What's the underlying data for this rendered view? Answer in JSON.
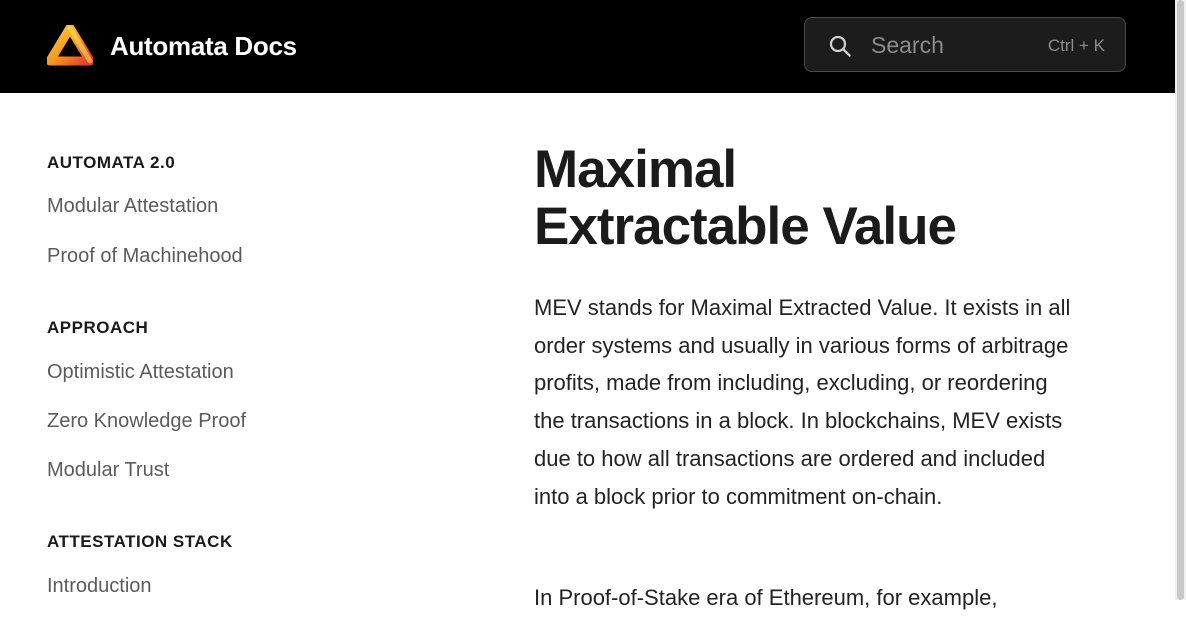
{
  "header": {
    "title": "Automata Docs",
    "logo_icon": "automata-triangle-logo",
    "background": "#000000"
  },
  "search": {
    "icon": "search-icon",
    "placeholder": "Search",
    "shortcut": "Ctrl + K"
  },
  "sidebar": {
    "sections": [
      {
        "title": "AUTOMATA 2.0",
        "items": [
          "Modular Attestation",
          "Proof of Machinehood"
        ]
      },
      {
        "title": "APPROACH",
        "items": [
          "Optimistic Attestation",
          "Zero Knowledge Proof",
          "Modular Trust"
        ]
      },
      {
        "title": "ATTESTATION STACK",
        "items": [
          "Introduction"
        ]
      }
    ]
  },
  "article": {
    "title_line1": "Maximal",
    "title_line2": "Extractable Value",
    "paragraphs": [
      "MEV stands for Maximal Extracted Value. It exists in all order systems and usually in various forms of arbitrage profits, made from including, excluding, or reordering the transactions in a block. In blockchains, MEV exists due to how all transactions are ordered and included into a block prior to commitment on-chain.",
      "In Proof-of-Stake era of Ethereum, for example,"
    ]
  },
  "colors": {
    "brand_orange": "#f5a623",
    "brand_red": "#e8452c",
    "text_dark": "#1b1b1b",
    "link_gray": "#5b5b5b"
  }
}
